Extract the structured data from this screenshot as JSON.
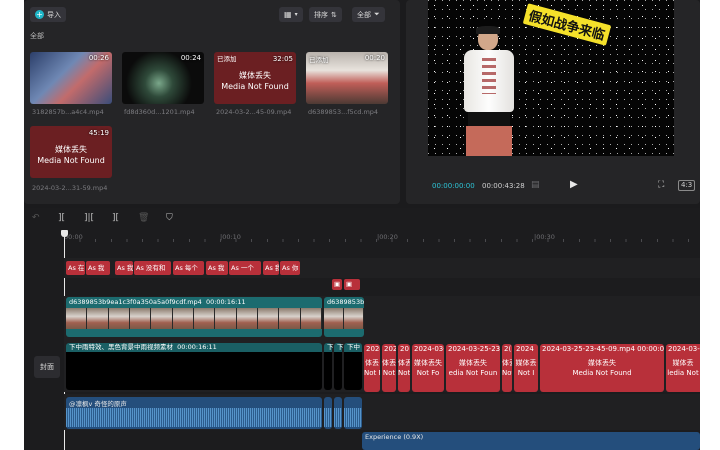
{
  "media": {
    "import_label": "导入",
    "sort_label": "排序",
    "filter_label": "全部",
    "section_label": "全部",
    "items": [
      {
        "name": "3182857b...a4c4.mp4",
        "duration": "00:26",
        "added": "",
        "missing": false
      },
      {
        "name": "fd8d360d...1201.mp4",
        "duration": "00:24",
        "added": "",
        "missing": false
      },
      {
        "name": "2024-03-2...45-09.mp4",
        "duration": "32:05",
        "added": "已添加",
        "missing": true
      },
      {
        "name": "d6389853...f5cd.mp4",
        "duration": "00:20",
        "added": "已添加",
        "missing": false
      },
      {
        "name": "2024-03-2...31-59.mp4",
        "duration": "45:19",
        "added": "",
        "missing": true
      }
    ],
    "missing_text_cn": "媒体丢失",
    "missing_text_en": "Media Not Found"
  },
  "player": {
    "overlay_text": "假如战争来临",
    "current_time": "00:00:00:00",
    "total_time": "00:00:43:28",
    "ratio_label": "4:3"
  },
  "timeline": {
    "ticks": [
      "00:00",
      "|00:10",
      "|00:20",
      "|00:30"
    ],
    "text_segments": [
      "As 在",
      "As 我",
      "As 我",
      "As 没有和",
      "As 每个",
      "As 我",
      "As 一个",
      "As 我",
      "As 你"
    ],
    "video_clip_1": {
      "name": "d6389853b9ea1c3f0a350a5a0f9cdf.mp4",
      "duration": "00:00:16:11"
    },
    "video_clip_2": {
      "name": "d6389853b"
    },
    "black_clip": {
      "label": "下中雨特效、黑色背景中雨视频素材",
      "duration": "00:00:16:11"
    },
    "cover_label": "封面",
    "red_clips": [
      {
        "title": "2024",
        "cn": "体丢",
        "en": "Not F"
      },
      {
        "title": "202",
        "cn": "体丢",
        "en": "Not"
      },
      {
        "title": "20",
        "cn": "体丢",
        "en": "Not"
      },
      {
        "title": "2024-03-",
        "cn": "媒体丢失",
        "en": "Not Fo"
      },
      {
        "title": "2024-03-25-23-",
        "cn": "媒体丢失",
        "en": "edia Not Foun"
      },
      {
        "title": "2(",
        "cn": "体丢",
        "en": "Not F"
      },
      {
        "title": "2024",
        "cn": "媒体丢",
        "en": "Not I"
      },
      {
        "title": "2024-03-25-23-45-09.mp4  00:00:08:",
        "cn": "媒体丢失",
        "en": "Media Not Found"
      },
      {
        "title": "2024-03-",
        "cn": "媒体丢",
        "en": "ledia Not"
      }
    ],
    "audio_label": "@凛枫v 奇怪的原声",
    "experience_label": "Experience (0.9X)"
  }
}
